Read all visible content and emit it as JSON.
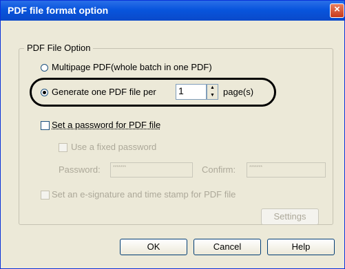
{
  "window": {
    "title": "PDF file format option"
  },
  "group": {
    "label": "PDF File Option"
  },
  "options": {
    "multipage_label": "Multipage PDF(whole batch in one PDF)",
    "per_file_label": "Generate one PDF file per",
    "pages_value": "1",
    "pages_unit": "page(s)",
    "selected": "per_file"
  },
  "password": {
    "set_label": "Set a password for PDF file",
    "fixed_label": "Use a fixed password",
    "password_label": "Password:",
    "password_value": "*******",
    "confirm_label": "Confirm:",
    "confirm_value": "*******"
  },
  "signature": {
    "label": "Set an e-signature and time stamp for PDF file",
    "settings_label": "Settings"
  },
  "buttons": {
    "ok": "OK",
    "cancel": "Cancel",
    "help": "Help"
  },
  "colors": {
    "titlebar": "#0855dd",
    "dialog": "#ece9d8",
    "disabled": "#aca899"
  }
}
